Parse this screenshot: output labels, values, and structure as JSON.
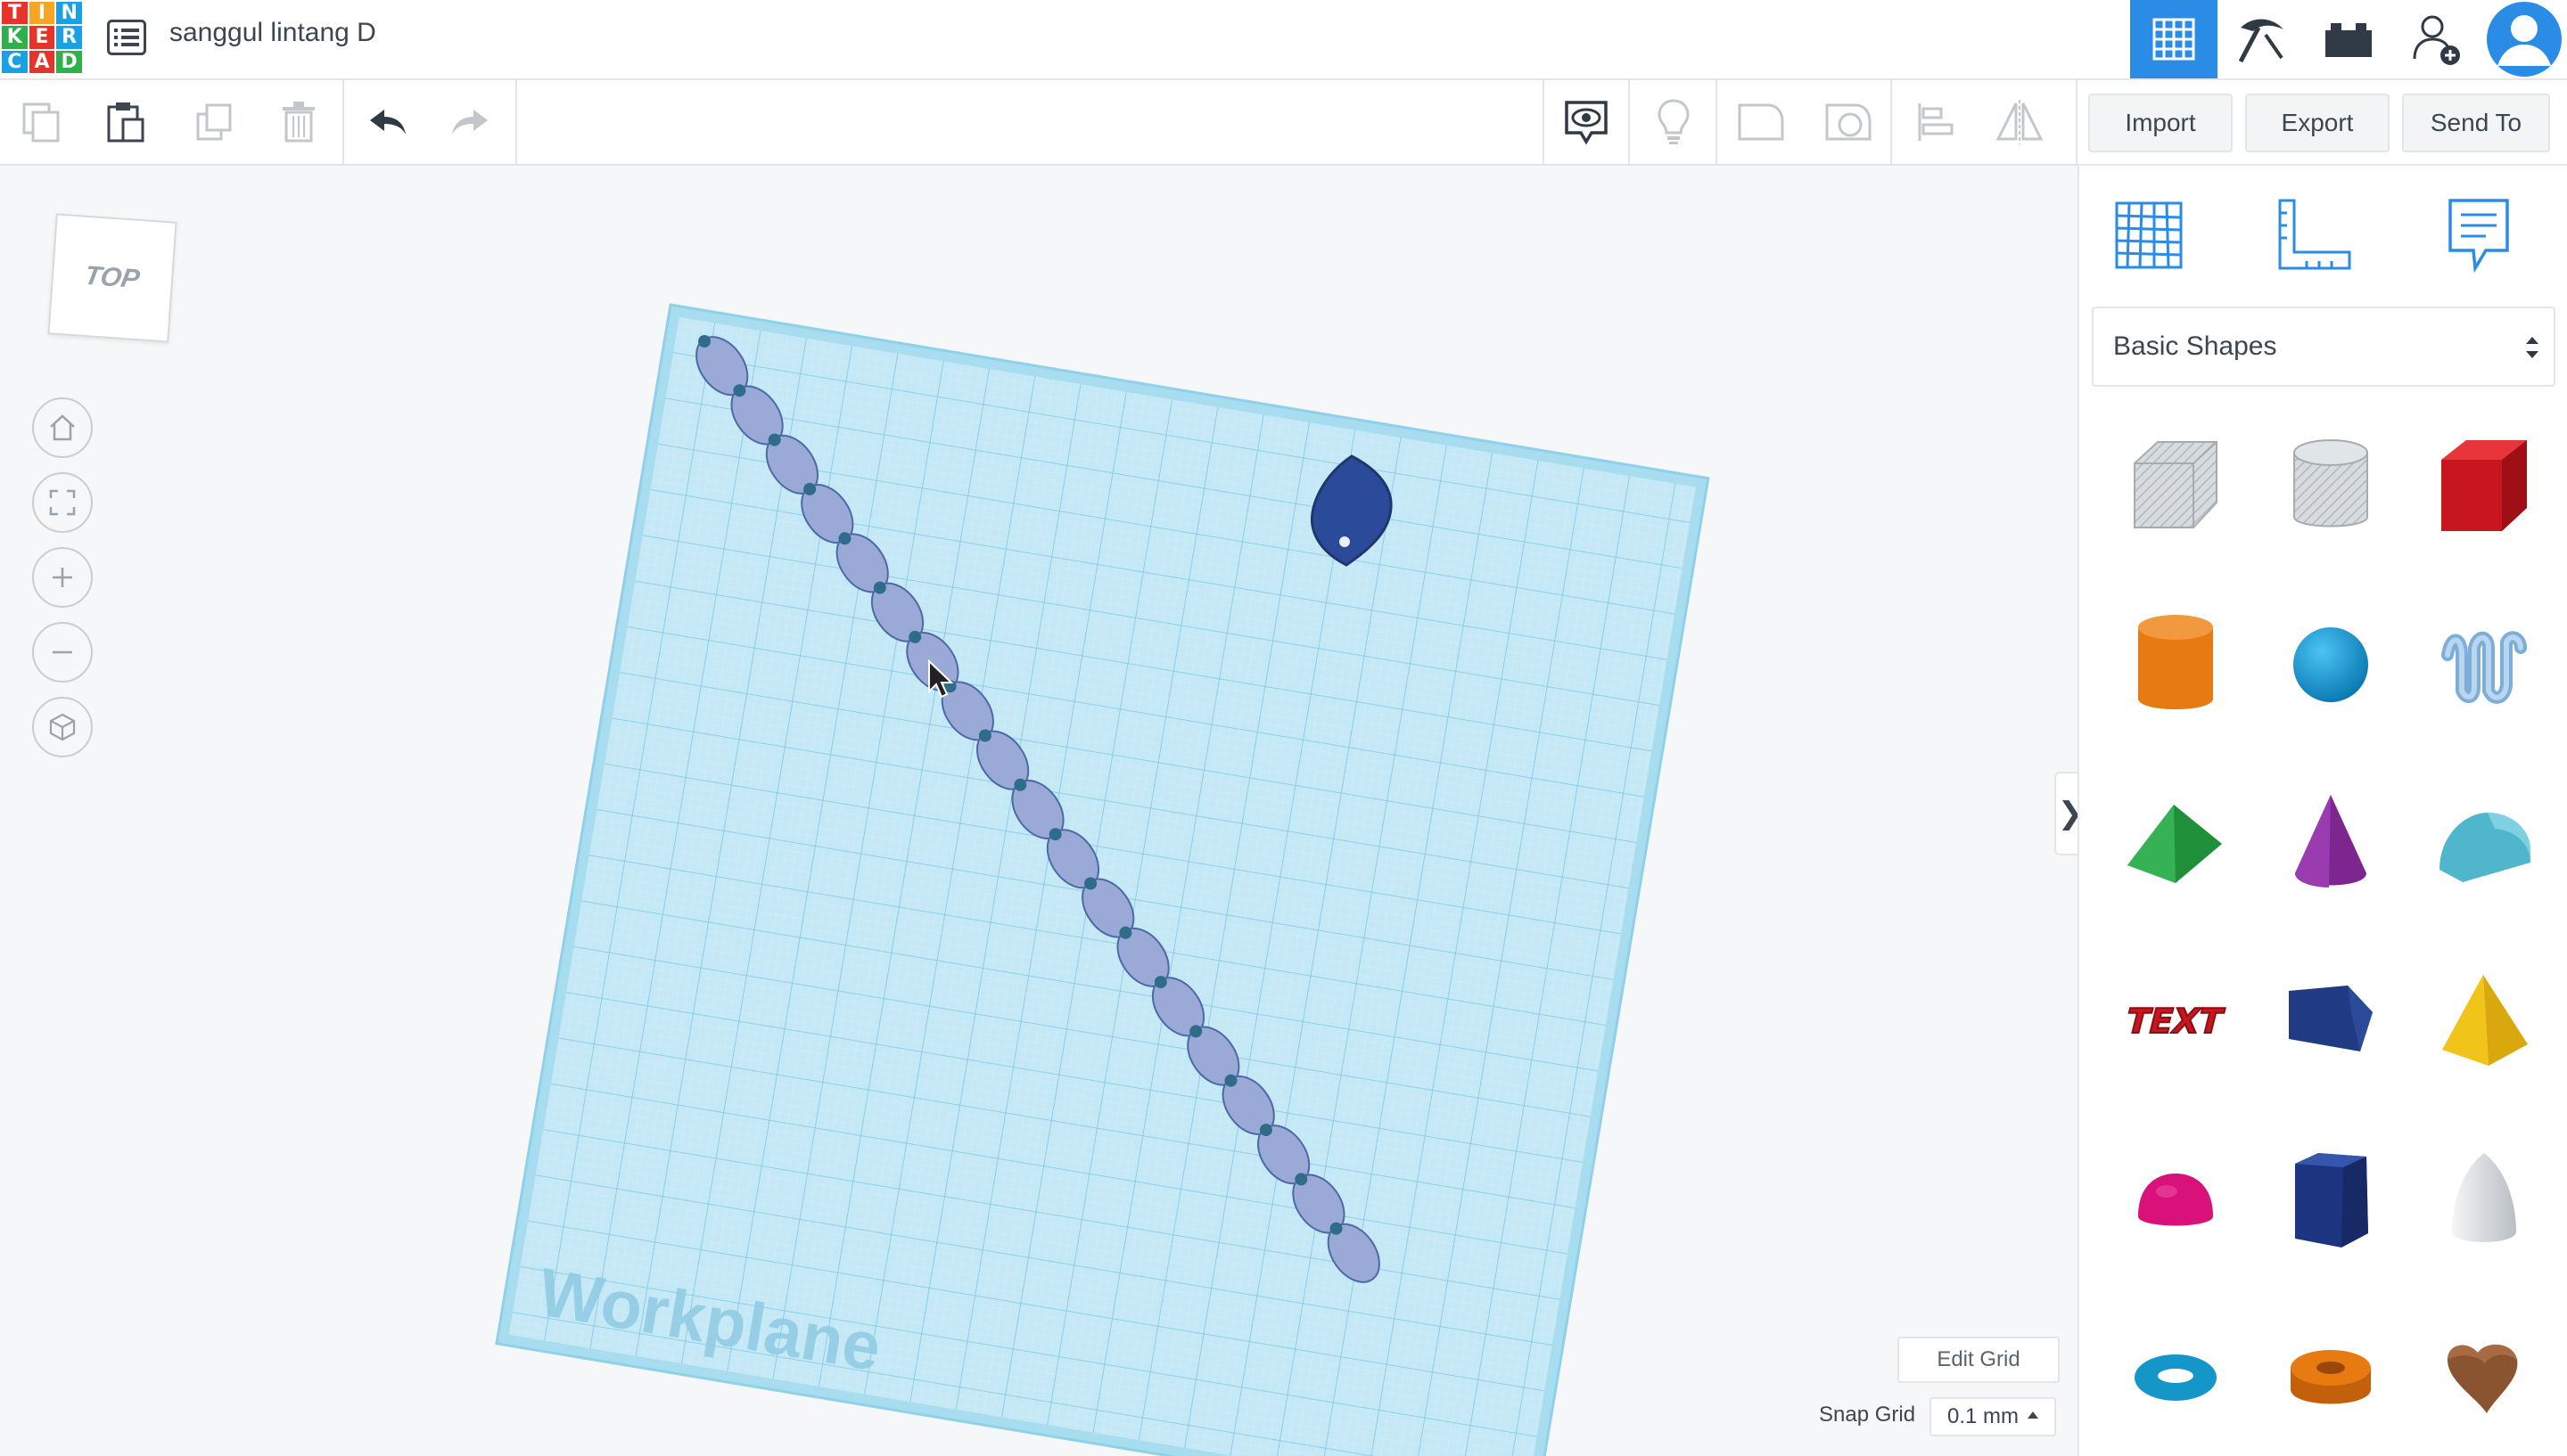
{
  "app": {
    "logo_letters": [
      "T",
      "I",
      "N",
      "K",
      "E",
      "R",
      "C",
      "A",
      "D"
    ],
    "logo_colors": [
      "#e8332a",
      "#f6a623",
      "#1aa0e4",
      "#2eb04a",
      "#e8332a",
      "#1aa0e4",
      "#1aa0e4",
      "#e8332a",
      "#2eb04a"
    ],
    "project_title": "sanggul lintang D"
  },
  "header": {
    "menu_icon": "list-icon",
    "right_icons": [
      "grid-view-icon",
      "pickaxe-icon",
      "bricks-icon",
      "add-user-icon",
      "avatar"
    ],
    "accent": "#2b8ce6"
  },
  "toolbar": {
    "left_tools": [
      "copy-icon",
      "paste-icon",
      "duplicate-icon",
      "trash-icon",
      "undo-icon",
      "redo-icon"
    ],
    "right_tools": [
      "notes-visibility-icon",
      "light-bulb-icon",
      "shape-hole-icon",
      "group-icon",
      "align-icon",
      "mirror-icon"
    ],
    "import_label": "Import",
    "export_label": "Export",
    "send_to_label": "Send To"
  },
  "viewport": {
    "viewcube_label": "TOP",
    "nav_buttons": [
      "home-view-icon",
      "fit-view-icon",
      "zoom-in-icon",
      "zoom-out-icon",
      "perspective-icon"
    ],
    "workplane_label": "Workplane",
    "workplane_color": "#a8dcef",
    "chain_link_color": "#9aa9d6",
    "chain_wire_color": "#2f6b8a",
    "leaf_color": "#2c4a9a",
    "edit_grid_label": "Edit Grid",
    "snap_grid_label": "Snap Grid",
    "snap_grid_value": "0.1 mm"
  },
  "sidebar": {
    "tabs": [
      "workplane-grid-icon",
      "ruler-icon",
      "notes-icon"
    ],
    "library_label": "Basic Shapes",
    "shapes": [
      "box-hole-shape",
      "cylinder-hole-shape",
      "box-shape",
      "cylinder-shape",
      "sphere-shape",
      "scribble-shape",
      "roof-shape",
      "cone-shape",
      "round-roof-shape",
      "text-shape",
      "prism-shape",
      "pyramid-shape",
      "half-sphere-shape",
      "polygon-shape",
      "paraboloid-shape",
      "torus-shape",
      "tube-shape",
      "heart-shape"
    ],
    "shape_text_label": "TEXT"
  }
}
